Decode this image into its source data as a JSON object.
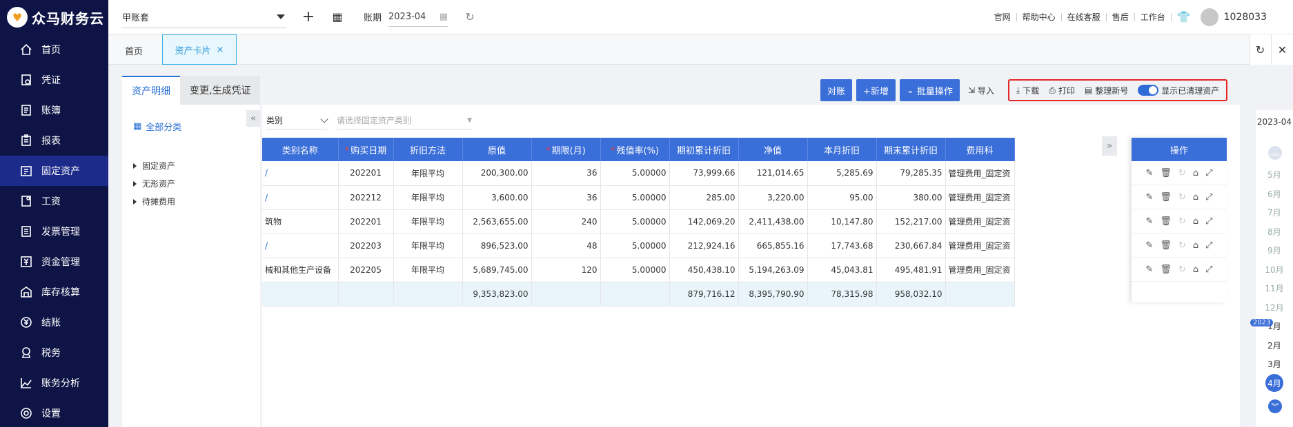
{
  "app": {
    "logo_text": "众马财务云"
  },
  "sidebar": {
    "items": [
      {
        "label": "首页",
        "icon": "home-icon"
      },
      {
        "label": "凭证",
        "icon": "voucher-icon"
      },
      {
        "label": "账簿",
        "icon": "ledger-icon"
      },
      {
        "label": "报表",
        "icon": "report-icon"
      },
      {
        "label": "固定资产",
        "icon": "asset-icon",
        "active": true
      },
      {
        "label": "工资",
        "icon": "salary-icon"
      },
      {
        "label": "发票管理",
        "icon": "invoice-icon"
      },
      {
        "label": "资金管理",
        "icon": "fund-icon"
      },
      {
        "label": "库存核算",
        "icon": "inventory-icon"
      },
      {
        "label": "结账",
        "icon": "checkout-icon"
      },
      {
        "label": "税务",
        "icon": "tax-icon"
      },
      {
        "label": "账务分析",
        "icon": "analysis-icon"
      },
      {
        "label": "设置",
        "icon": "gear-icon"
      }
    ]
  },
  "topbar": {
    "account": "甲账套",
    "period_label": "账期",
    "period_value": "2023-04",
    "links": [
      "官网",
      "帮助中心",
      "在线客服",
      "售后",
      "工作台"
    ],
    "user_id": "1028033"
  },
  "tabs": {
    "home": "首页",
    "active": "资产卡片",
    "close": "×"
  },
  "subtabs": {
    "detail": "资产明细",
    "change": "变更,生成凭证"
  },
  "tree": {
    "all": "全部分类",
    "nodes": [
      "固定资产",
      "无形资产",
      "待摊费用"
    ]
  },
  "toolbar": {
    "reconcile": "对账",
    "add": "+新增",
    "batch": "批量操作",
    "import": "导入",
    "download": "下载",
    "print": "打印",
    "renumber": "整理新号",
    "show_cleared": "显示已清理资产"
  },
  "filter": {
    "category": "类别",
    "type_placeholder": "请选择固定资产类别"
  },
  "table": {
    "headers": [
      "类别名称",
      "购买日期",
      "折旧方法",
      "原值",
      "期限(月)",
      "残值率(%)",
      "期初累计折旧",
      "净值",
      "本月折旧",
      "期末累计折旧",
      "费用科"
    ],
    "rows": [
      [
        "",
        "202201",
        "年限平均",
        "200,300.00",
        "36",
        "5.00000",
        "73,999.66",
        "121,014.65",
        "5,285.69",
        "79,285.35",
        "管理费用_固定资"
      ],
      [
        "",
        "202212",
        "年限平均",
        "3,600.00",
        "36",
        "5.00000",
        "285.00",
        "3,220.00",
        "95.00",
        "380.00",
        "管理费用_固定资"
      ],
      [
        "筑物",
        "202201",
        "年限平均",
        "2,563,655.00",
        "240",
        "5.00000",
        "142,069.20",
        "2,411,438.00",
        "10,147.80",
        "152,217.00",
        "管理费用_固定资"
      ],
      [
        "",
        "202203",
        "年限平均",
        "896,523.00",
        "48",
        "5.00000",
        "212,924.16",
        "665,855.16",
        "17,743.68",
        "230,667.84",
        "管理费用_固定资"
      ],
      [
        "械和其他生产设备",
        "202205",
        "年限平均",
        "5,689,745.00",
        "120",
        "5.00000",
        "450,438.10",
        "5,194,263.09",
        "45,043.81",
        "495,481.91",
        "管理费用_固定资"
      ]
    ],
    "totals": [
      "",
      "",
      "",
      "9,353,823.00",
      "",
      "",
      "879,716.12",
      "8,395,790.90",
      "78,315.98",
      "958,032.10",
      ""
    ],
    "ops_header": "操作"
  },
  "date_strip": {
    "current": "2023-04",
    "year_badge": "2023",
    "months_before": [
      "5月",
      "6月",
      "7月",
      "8月",
      "9月",
      "10月",
      "11月",
      "12月"
    ],
    "months_after": [
      "1月",
      "2月",
      "3月"
    ],
    "current_month": "4月"
  }
}
